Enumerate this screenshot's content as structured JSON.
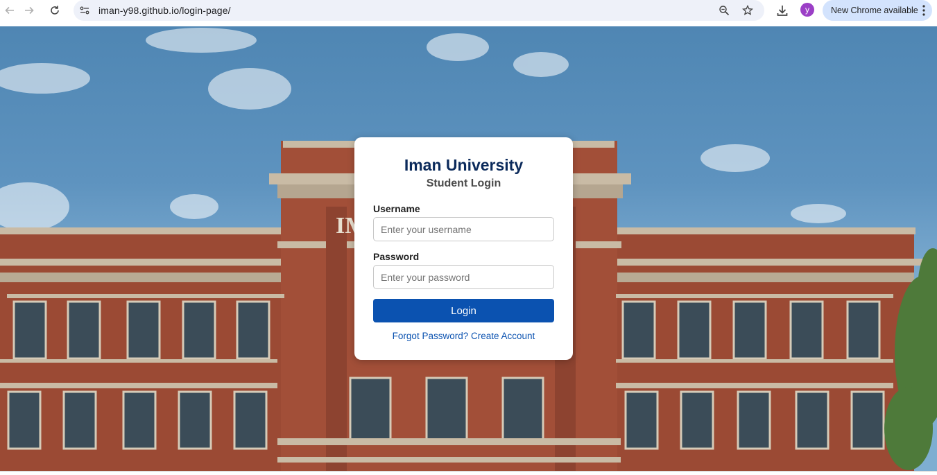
{
  "browser": {
    "url": "iman-y98.github.io/login-page/",
    "profile_initial": "y",
    "update_label": "New Chrome available",
    "icons": [
      "back-icon",
      "forward-icon",
      "reload-icon",
      "site-info-icon",
      "zoom-icon",
      "bookmark-star-icon",
      "download-icon",
      "more-icon"
    ]
  },
  "login": {
    "title": "Iman University",
    "subtitle": "Student Login",
    "username_label": "Username",
    "username_placeholder": "Enter your username",
    "password_label": "Password",
    "password_placeholder": "Enter your password",
    "login_label": "Login",
    "forgot_label": "Forgot Password?",
    "create_label": "Create Account"
  },
  "colors": {
    "accent": "#0b52b0",
    "title": "#0b2a5b",
    "update_chip": "#d3e3fd",
    "avatar": "#9b3fc6"
  }
}
